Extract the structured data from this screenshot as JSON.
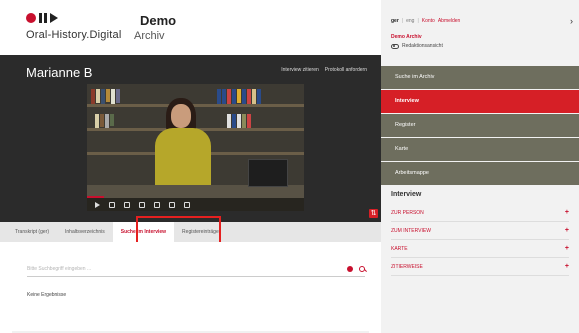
{
  "header": {
    "logo_text": "Oral-History.Digital",
    "brand_title": "Demo",
    "brand_subtitle": "Archiv"
  },
  "video": {
    "interviewee": "Marianne B",
    "cite_label": "Interview zitieren",
    "print_label": "Protokoll anfordern"
  },
  "tabs": [
    {
      "label": "Transkript (ger)"
    },
    {
      "label": "Inhaltsverzeichnis"
    },
    {
      "label": "Suche im Interview",
      "active": true
    },
    {
      "label": "Registereinträge"
    }
  ],
  "search": {
    "placeholder": "Bitte Suchbegriff eingeben ...",
    "no_results": "Keine Ergebnisse"
  },
  "sidebar": {
    "lang_ger": "ger",
    "lang_eng": "eng",
    "konto": "Konto",
    "abmelden": "Abmelden",
    "archive_name": "Demo Archiv",
    "edit_view": "Redaktionsansicht",
    "nav": [
      {
        "label": "Suche im Archiv"
      },
      {
        "label": "Interview",
        "active": true
      },
      {
        "label": "Register"
      },
      {
        "label": "Karte"
      },
      {
        "label": "Arbeitsmappe"
      }
    ],
    "section_title": "Interview",
    "links": [
      {
        "label": "ZUR PERSON"
      },
      {
        "label": "ZUM INTERVIEW"
      },
      {
        "label": "KARTE"
      },
      {
        "label": "ZITIERWEISE"
      }
    ]
  },
  "colors": {
    "accent": "#c8102e",
    "nav_bg": "#6e6e5e",
    "video_bg": "#2b2b2b"
  }
}
